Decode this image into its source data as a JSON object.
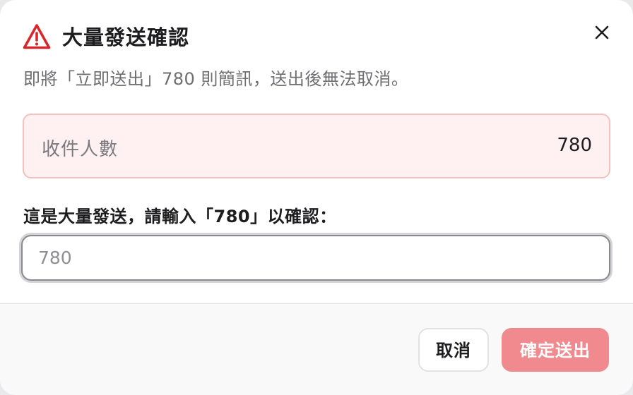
{
  "dialog": {
    "title": "大量發送確認",
    "subtitle": "即將「立即送出」780 則簡訊，送出後無法取消。",
    "icons": {
      "warning": "warning-triangle-icon",
      "close": "close-icon"
    },
    "colors": {
      "warning": "#d9262b",
      "danger_bg": "#fff1f1",
      "danger_border": "#f5c0c0",
      "submit": "#f08a8e"
    }
  },
  "recipient": {
    "label": "收件人數",
    "value": "780"
  },
  "confirm": {
    "label": "這是大量發送，請輸入「780」以確認：",
    "placeholder": "780",
    "value": ""
  },
  "footer": {
    "cancel_label": "取消",
    "submit_label": "確定送出"
  }
}
